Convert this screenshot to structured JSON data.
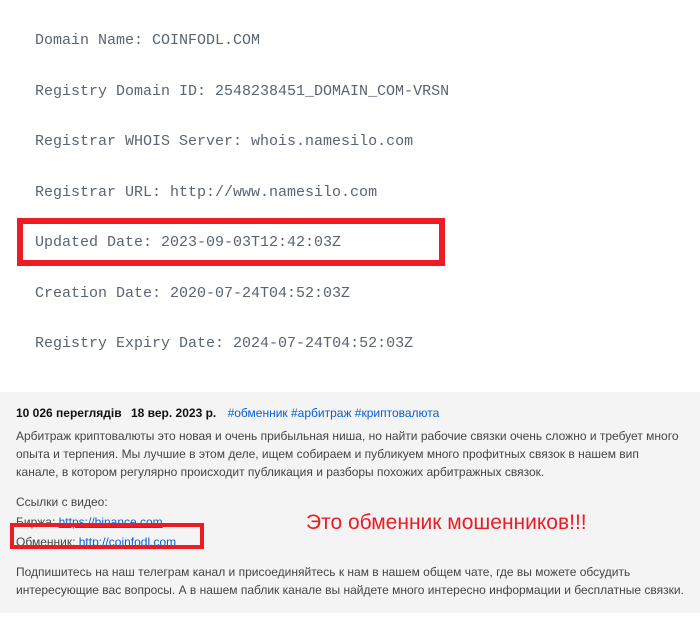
{
  "whois": {
    "domain_name_label": "Domain Name: ",
    "domain_name_value": "COINFODL.COM",
    "registry_id_label": "Registry Domain ID: ",
    "registry_id_value": "2548238451_DOMAIN_COM-VRSN",
    "whois_server_label": "Registrar WHOIS Server: ",
    "whois_server_value": "whois.namesilo.com",
    "registrar_url_label": "Registrar URL: ",
    "registrar_url_value": "http://www.namesilo.com",
    "updated_label": "Updated Date: ",
    "updated_value": "2023-09-03T12:42:03Z",
    "creation_label": "Creation Date: ",
    "creation_value": "2020-07-24T04:52:03Z",
    "expiry_label": "Registry Expiry Date: ",
    "expiry_value": "2024-07-24T04:52:03Z"
  },
  "desc": {
    "views": "10 026 переглядів",
    "date": "18 вер. 2023 р.",
    "hashtags": "#обменник #арбитраж #криптовалюта",
    "text": "Арбитраж криптовалюты это новая и очень прибыльная ниша, но найти рабочие связки очень сложно и требует много опыта и терпения. Мы лучшие в этом деле, ищем собираем и публикуем много профитных связок в нашем вип канале, в котором регулярно происходит публикация и разборы похожих арбитражных связок.",
    "links_header": "Ссылки с видео:",
    "exchange_label": "Биржа: ",
    "exchange_url": "https://binance.com",
    "exchanger_label": "Обменник: ",
    "exchanger_url": "http://coinfodl.com",
    "warning": "Это обменник мошенников!!!",
    "footer": "Подпишитесь на наш телеграм канал и присоединяйтесь к нам в нашем общем чате, где вы можете обсудить интересующие вас вопросы. А в нашем паблик канале вы найдете много интересно информации и бесплатные связки."
  }
}
